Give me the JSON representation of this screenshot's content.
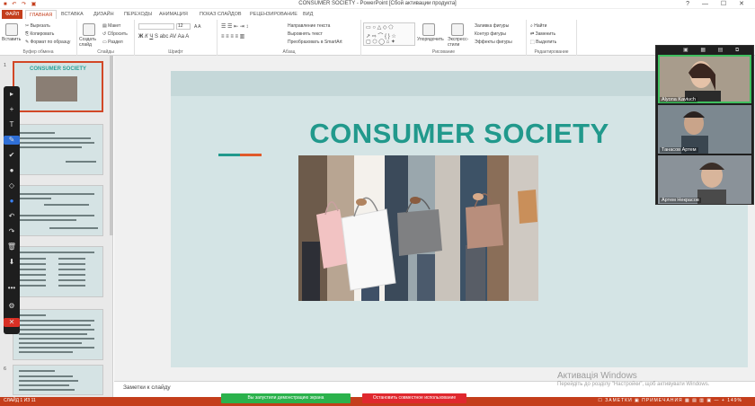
{
  "window": {
    "title": "CONSUMER SOCIETY - PowerPoint [Сбой активации продукта]",
    "controls": [
      "?",
      "—",
      "☐",
      "✕"
    ]
  },
  "ribbon_tabs": [
    "ФАЙЛ",
    "ГЛАВНАЯ",
    "ВСТАВКА",
    "ДИЗАЙН",
    "ПЕРЕХОДЫ",
    "АНИМАЦИЯ",
    "ПОКАЗ СЛАЙДОВ",
    "РЕЦЕНЗИРОВАНИЕ",
    "ВИД"
  ],
  "ribbon": {
    "clipboard": {
      "label": "Буфер обмена",
      "paste": "Вставить",
      "cut": "Вырезать",
      "copy": "Копировать",
      "format_painter": "Формат по образцу"
    },
    "slides": {
      "label": "Слайды",
      "new_slide": "Создать слайд",
      "layout": "Макет",
      "reset": "Сбросить",
      "section": "Раздел"
    },
    "font": {
      "label": "Шрифт",
      "size": "12"
    },
    "paragraph": {
      "label": "Абзац",
      "text_direction": "Направление текста",
      "align_text": "Выровнять текст",
      "smartart": "Преобразовать в SmartArt"
    },
    "drawing": {
      "label": "Рисование",
      "arrange": "Упорядочить",
      "quick_styles": "Экспресс-стили",
      "shape_fill": "Заливка фигуры",
      "shape_outline": "Контур фигуры",
      "shape_effects": "Эффекты фигуры"
    },
    "editing": {
      "label": "Редактирование",
      "find": "Найти",
      "replace": "Заменить",
      "select": "Выделить"
    }
  },
  "slide_numbers": [
    "1",
    "2",
    "3",
    "4",
    "5",
    "6"
  ],
  "slide": {
    "title": "CONSUMER SOCIETY",
    "accent_colors": [
      "#21998c",
      "#e05a2b"
    ]
  },
  "notes_placeholder": "Заметки к слайду",
  "status": {
    "slide_counter": "СЛАЙД 1 ИЗ 11",
    "right": "☐ ЗАМЕТКИ   ▣ ПРИМЕЧАНИЯ   ▦ ▤ ▥ ▣   —  +  149%"
  },
  "sharing": {
    "screen_share": "Вы запустили демонстрацию экрана",
    "stop_sharing": "Остановить совместное использование"
  },
  "watermark": {
    "line1": "Активація Windows",
    "line2": "Перейдіть до розділу \"Настройки\", щоб активувати Windows."
  },
  "participants": [
    {
      "name": "Alyona Kaviuch"
    },
    {
      "name": "Танасов Артем"
    },
    {
      "name": "Артем Некрасов"
    }
  ],
  "drawbar_tools": [
    "▸",
    "+",
    "T",
    "✎",
    "✔",
    "●",
    "◇",
    "●",
    "↶",
    "↷",
    "🗑",
    "⬇",
    "•••",
    "⚙",
    "✕"
  ]
}
